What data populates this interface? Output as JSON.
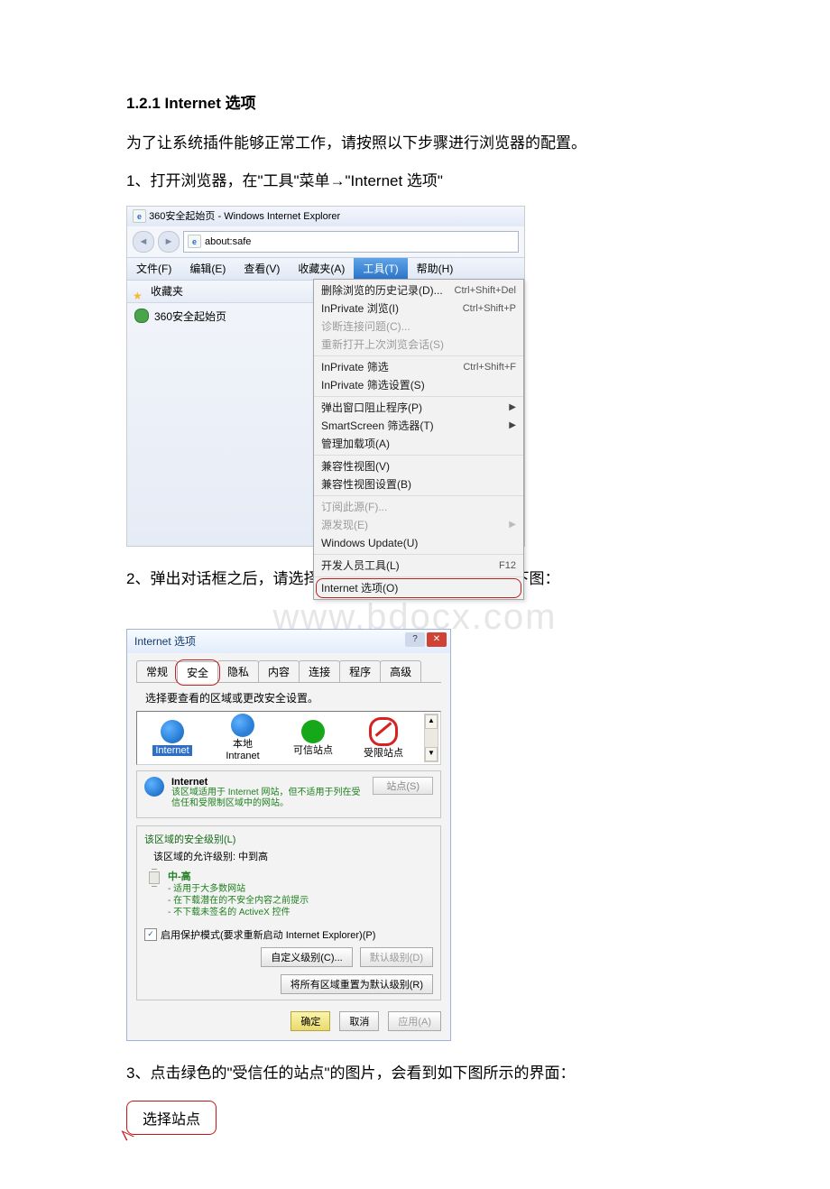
{
  "heading": "1.2.1 Internet 选项",
  "intro": "为了让系统插件能够正常工作，请按照以下步骤进行浏览器的配置。",
  "step1": "1、打开浏览器，在\"工具\"菜单→\"Internet 选项\"",
  "step2": "2、弹出对话框之后，请选择\"安全\"选项卡，具体的界面如下图：",
  "step3": "3、点击绿色的\"受信任的站点\"的图片，会看到如下图所示的界面：",
  "watermark": "www.bdocx.com",
  "callout": "选择站点",
  "ie": {
    "title": "360安全起始页 - Windows Internet Explorer",
    "address": "about:safe",
    "menu": {
      "file": "文件(F)",
      "edit": "编辑(E)",
      "view": "查看(V)",
      "fav": "收藏夹(A)",
      "tools": "工具(T)",
      "help": "帮助(H)"
    },
    "fav_label": "收藏夹",
    "tab_label": "360安全起始页",
    "menu_items": {
      "g1": {
        "del_history": "删除浏览的历史记录(D)...",
        "del_history_sc": "Ctrl+Shift+Del",
        "inprivate_browse": "InPrivate 浏览(I)",
        "inprivate_browse_sc": "Ctrl+Shift+P",
        "diagnose": "诊断连接问题(C)...",
        "reopen": "重新打开上次浏览会话(S)"
      },
      "g2": {
        "inprivate_filter": "InPrivate 筛选",
        "inprivate_filter_sc": "Ctrl+Shift+F",
        "inprivate_filter_set": "InPrivate 筛选设置(S)"
      },
      "g3": {
        "popup": "弹出窗口阻止程序(P)",
        "smartscreen": "SmartScreen 筛选器(T)",
        "addons": "管理加载项(A)"
      },
      "g4": {
        "compat": "兼容性视图(V)",
        "compat_set": "兼容性视图设置(B)"
      },
      "g5": {
        "feeds_sub": "订阅此源(F)...",
        "feeds_disc": "源发现(E)",
        "wu": "Windows Update(U)"
      },
      "g6": {
        "dev": "开发人员工具(L)",
        "dev_sc": "F12"
      },
      "g7": {
        "options": "Internet 选项(O)"
      }
    }
  },
  "dlg": {
    "title": "Internet 选项",
    "tabs": {
      "gen": "常规",
      "sec": "安全",
      "priv": "隐私",
      "content": "内容",
      "conn": "连接",
      "prog": "程序",
      "adv": "高级"
    },
    "subtitle": "选择要查看的区域或更改安全设置。",
    "zones": {
      "internet": "Internet",
      "intranet": "本地",
      "intranet2": "Intranet",
      "trusted": "可信站点",
      "restricted": "受限站点"
    },
    "frame_title": "Internet",
    "frame_desc": "该区域适用于 Internet 网站，但不适用于列在受信任和受限制区域中的网站。",
    "sites_btn": "站点(S)",
    "level_group": "该区域的安全级别(L)",
    "level_allowed": "该区域的允许级别: 中到高",
    "level_name": "中-高",
    "bullet1": "- 适用于大多数网站",
    "bullet2": "- 在下载潜在的不安全内容之前提示",
    "bullet3": "- 不下载未签名的 ActiveX 控件",
    "protected": "启用保护模式(要求重新启动 Internet Explorer)(P)",
    "btn_custom": "自定义级别(C)...",
    "btn_default": "默认级别(D)",
    "btn_reset": "将所有区域重置为默认级别(R)",
    "btn_ok": "确定",
    "btn_cancel": "取消",
    "btn_apply": "应用(A)"
  }
}
